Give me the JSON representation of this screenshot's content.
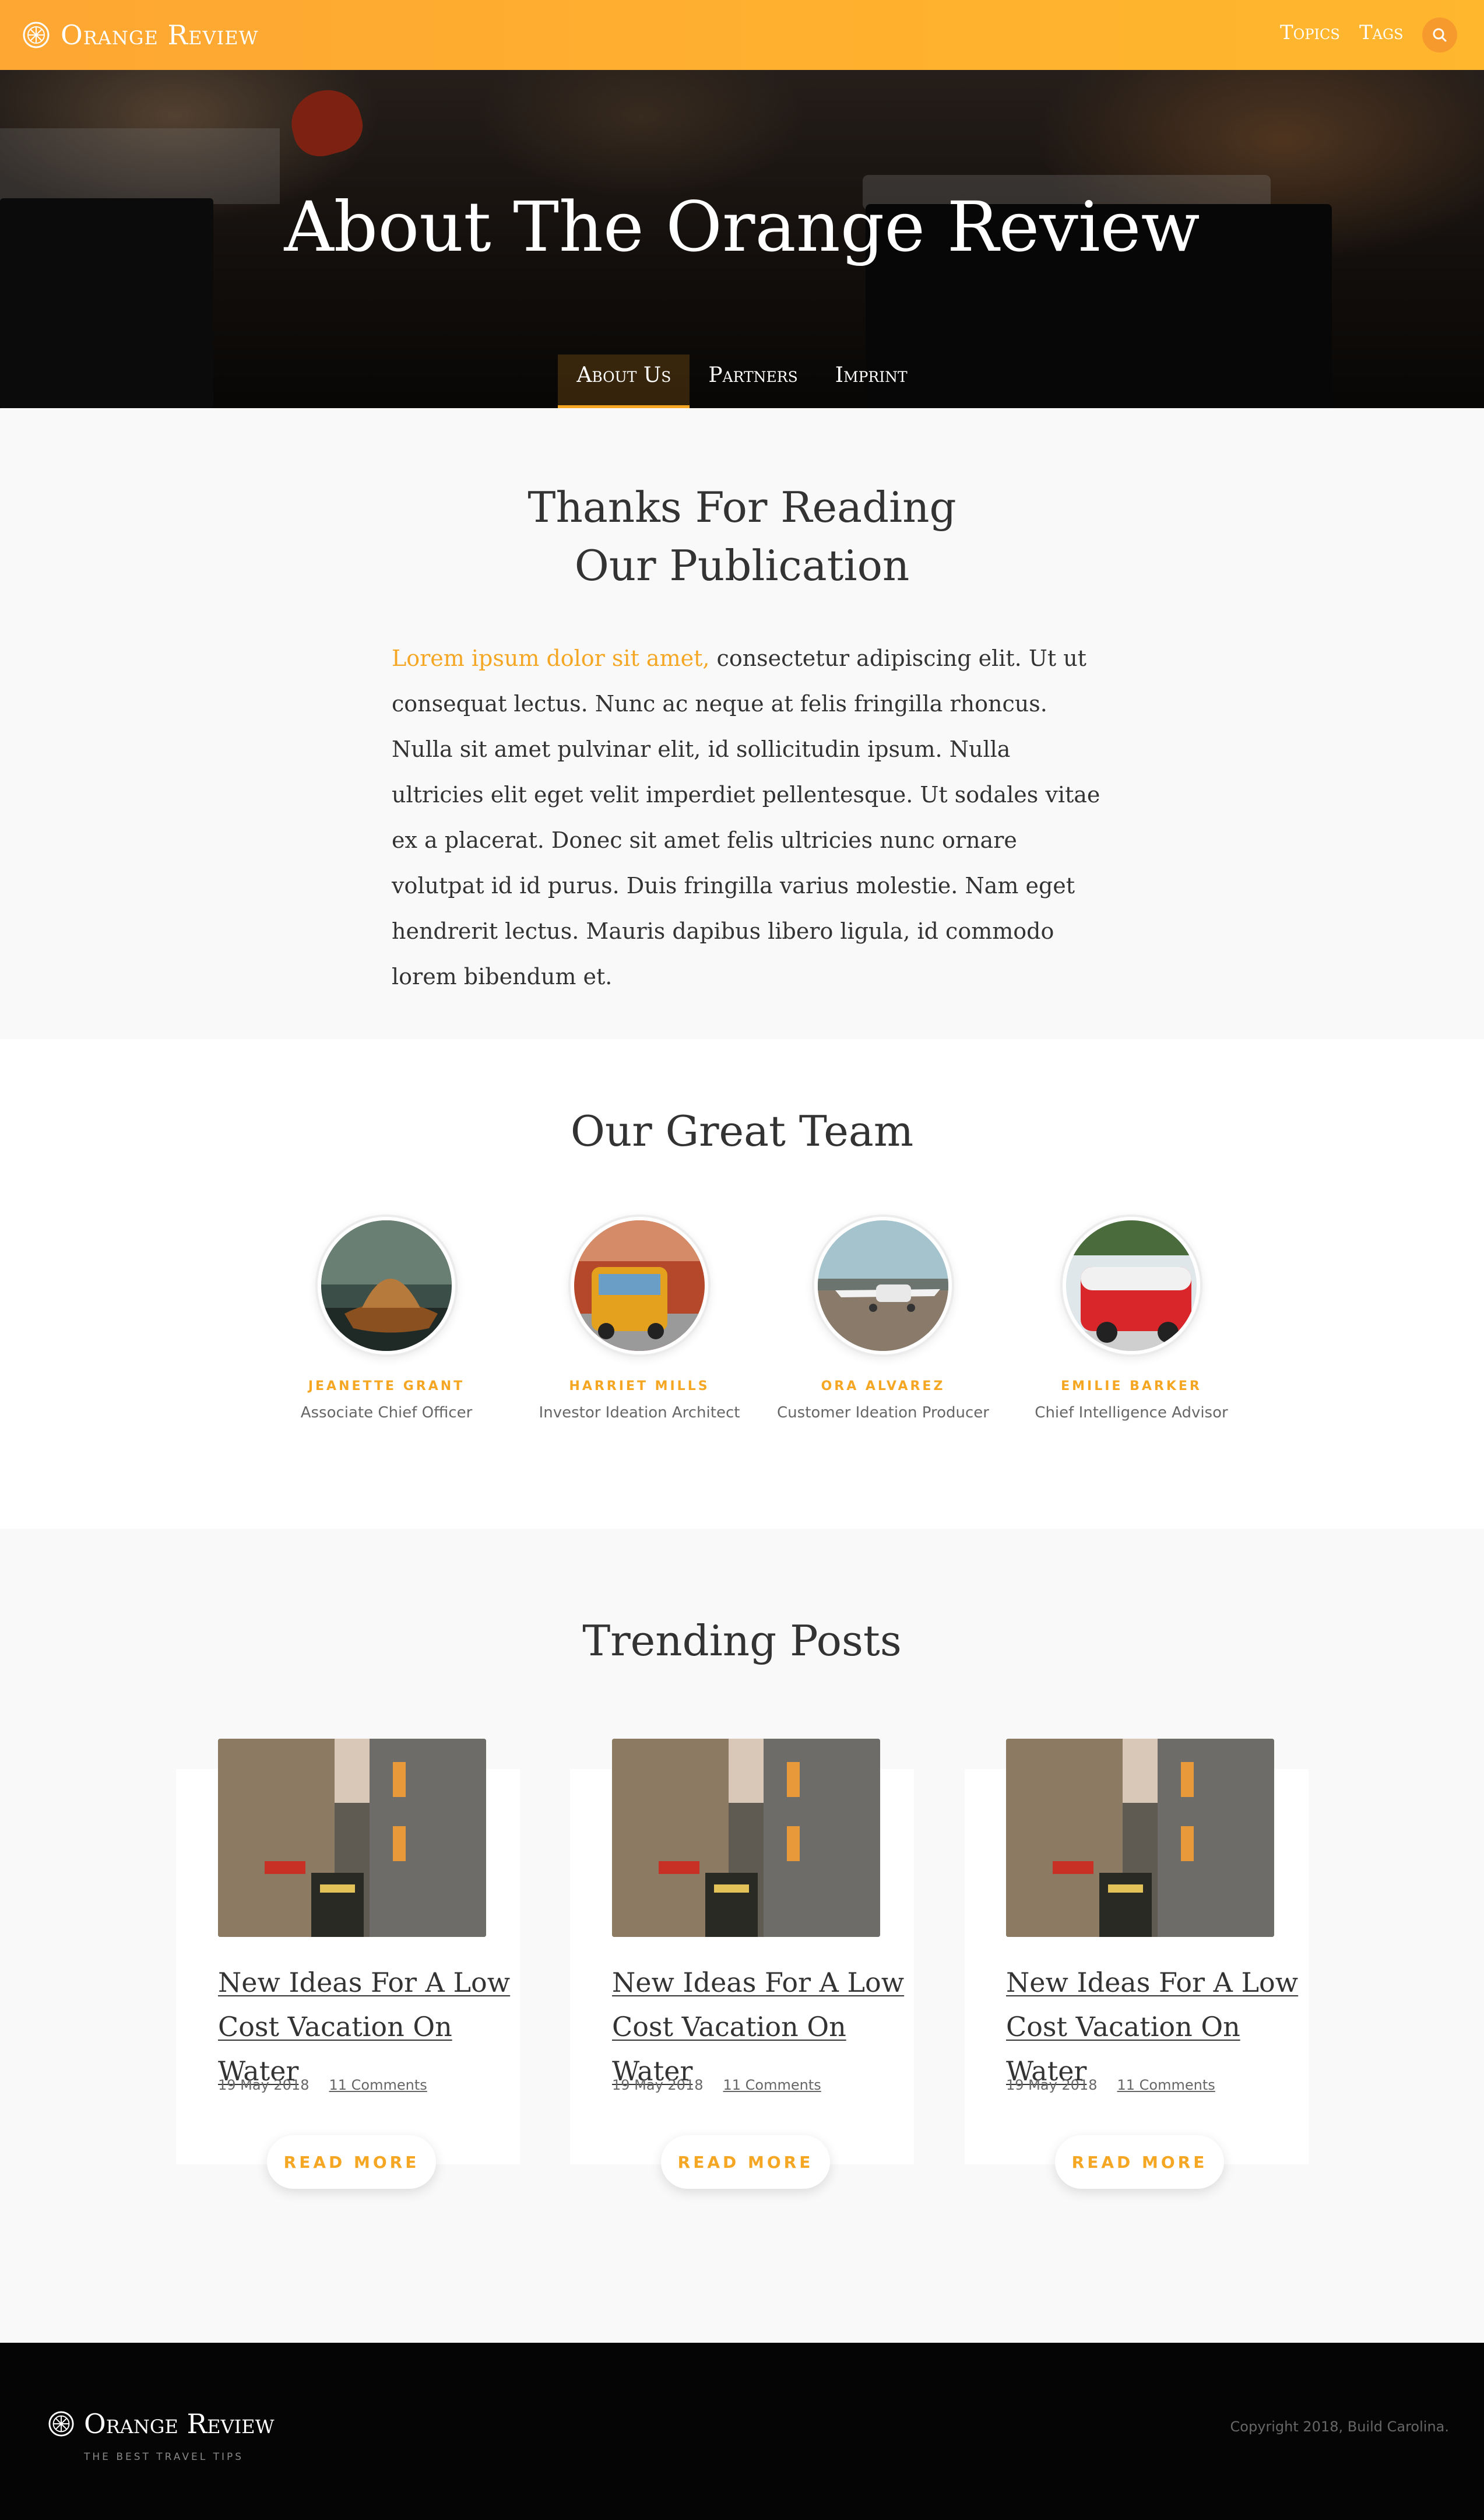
{
  "nav": {
    "brand": "Orange Review",
    "links": [
      "Topics",
      "Tags"
    ],
    "search_icon": "search-icon",
    "accent": "#f5a623"
  },
  "hero": {
    "title": "About The Orange Review",
    "tabs": [
      {
        "label": "About Us",
        "active": true
      },
      {
        "label": "Partners",
        "active": false
      },
      {
        "label": "Imprint",
        "active": false
      }
    ]
  },
  "intro": {
    "title_line1": "Thanks For Reading",
    "title_line2": "Our Publication",
    "highlight": "Lorem ipsum dolor sit amet,",
    "body": " consectetur adipiscing elit. Ut ut consequat lectus. Nunc ac neque at felis fringilla rhoncus. Nulla sit amet pulvinar elit, id sollicitudin ipsum. Nulla ultricies elit eget velit imperdiet pellentesque. Ut sodales vitae ex a placerat. Donec sit amet felis ultricies nunc ornare volutpat id id purus. Duis fringilla varius molestie. Nam eget hendrerit lectus. Mauris dapibus libero ligula, id commodo lorem bibendum et."
  },
  "team": {
    "title": "Our Great Team",
    "members": [
      {
        "name": "Jeanette Grant",
        "role": "Associate Chief  Officer"
      },
      {
        "name": "Harriet Mills",
        "role": "Investor Ideation Architect"
      },
      {
        "name": "Ora Alvarez",
        "role": "Customer Ideation Producer"
      },
      {
        "name": "Emilie Barker",
        "role": "Chief Intelligence Advisor"
      }
    ]
  },
  "trending": {
    "title": "Trending Posts",
    "posts": [
      {
        "title": "New Ideas For A Low Cost Vacation On Water",
        "date": "19 May 2018",
        "comments": "11 Comments",
        "button": "Read More"
      },
      {
        "title": "New Ideas For A Low Cost Vacation On Water",
        "date": "19 May 2018",
        "comments": "11 Comments",
        "button": "Read More"
      },
      {
        "title": "New Ideas For A Low Cost Vacation On Water",
        "date": "19 May 2018",
        "comments": "11 Comments",
        "button": "Read More"
      }
    ]
  },
  "footer": {
    "brand": "Orange Review",
    "tagline": "The Best Travel Tips",
    "copyright": "Copyright 2018, Build Carolina."
  }
}
